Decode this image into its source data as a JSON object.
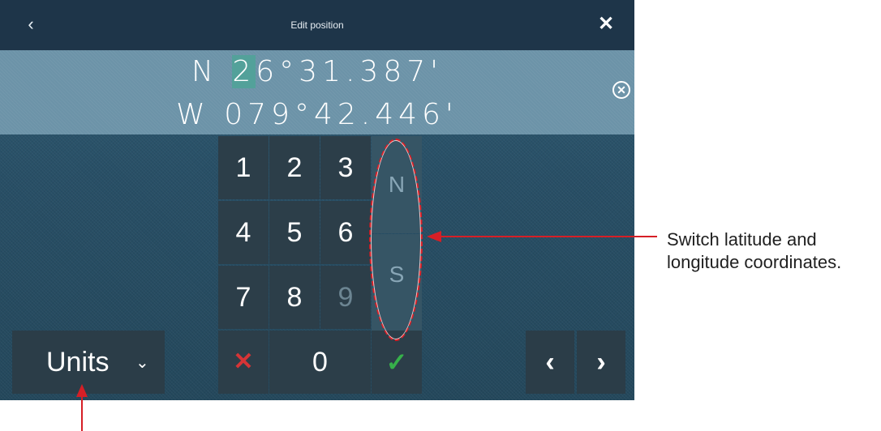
{
  "window": {
    "title": "Edit position"
  },
  "icons": {
    "back": "chevron-left-icon",
    "close": "close-icon",
    "clear_field": "circle-x-icon"
  },
  "position": {
    "lat": {
      "hemisphere": "N",
      "cursor_digit": "2",
      "rest": "6°31.387'"
    },
    "lon": {
      "hemisphere": "W",
      "value": "079°42.446'"
    }
  },
  "keypad": {
    "digits": [
      "1",
      "2",
      "3",
      "4",
      "5",
      "6",
      "7",
      "8",
      "9"
    ],
    "disabled_digit": "9",
    "zero": "0",
    "clear_symbol": "✕",
    "confirm_symbol": "✓",
    "hemisphere_keys": [
      "N",
      "S"
    ]
  },
  "units": {
    "label": "Units",
    "chevron": "⌄"
  },
  "nav": {
    "left": "‹",
    "right": "›"
  },
  "annotation": {
    "callout_line1": "Switch latitude and",
    "callout_line2": "longitude coordinates."
  },
  "colors": {
    "titlebar": "#1e3549",
    "cursor": "#53a19a",
    "clear": "#d63436",
    "confirm": "#36b04a",
    "annotation": "#d61f26"
  }
}
